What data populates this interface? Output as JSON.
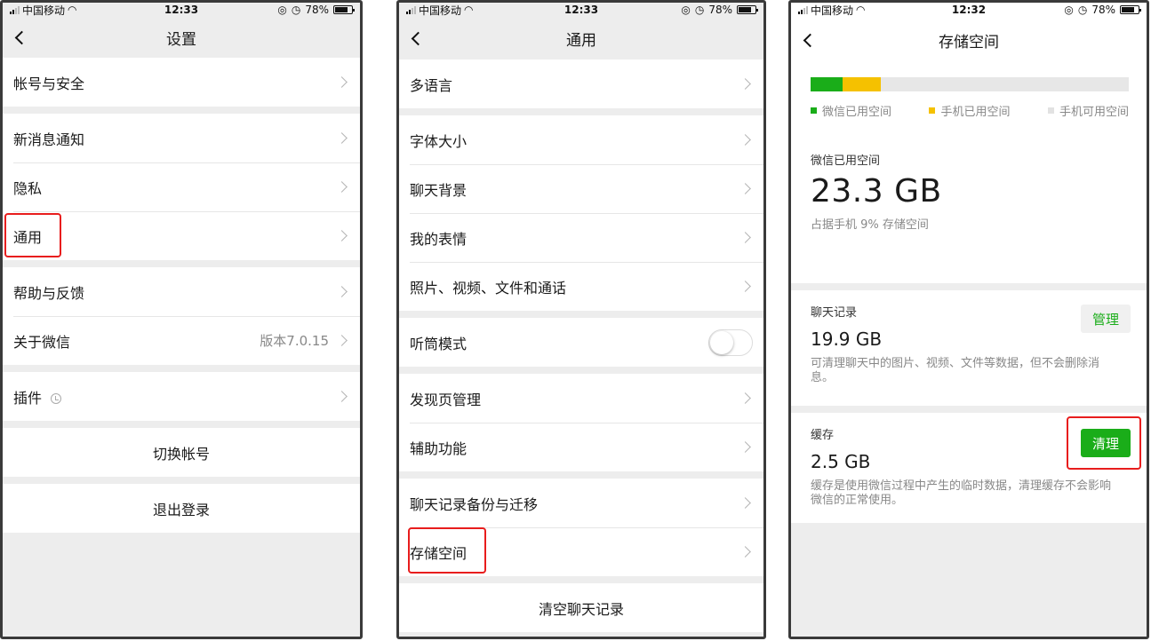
{
  "status": {
    "carrier": "中国移动",
    "time_1": "12:33",
    "time_2": "12:33",
    "time_3": "12:32",
    "battery": "78%",
    "battery_level": 0.78
  },
  "settings": {
    "title": "设置",
    "groups": [
      [
        "帐号与安全"
      ],
      [
        "新消息通知",
        "隐私",
        "通用"
      ],
      [
        "帮助与反馈",
        "关于微信"
      ],
      [
        "插件"
      ]
    ],
    "version_value": "版本7.0.15",
    "switch_account": "切换帐号",
    "logout": "退出登录"
  },
  "general": {
    "title": "通用",
    "groups": [
      [
        "多语言"
      ],
      [
        "字体大小",
        "聊天背景",
        "我的表情",
        "照片、视频、文件和通话"
      ],
      [
        "听筒模式"
      ],
      [
        "发现页管理",
        "辅助功能"
      ],
      [
        "聊天记录备份与迁移",
        "存储空间"
      ]
    ],
    "earpiece_mode_on": false,
    "clear_chat": "清空聊天记录"
  },
  "storage": {
    "title": "存储空间",
    "bar": {
      "wechat_fraction": 0.1,
      "phone_fraction": 0.12
    },
    "legend": {
      "wechat_used": "微信已用空间",
      "phone_used": "手机已用空间",
      "phone_available": "手机可用空间"
    },
    "colors": {
      "wechat": "#1aad19",
      "phone": "#f5c100",
      "free": "#e7e7e7"
    },
    "used_label": "微信已用空间",
    "used_size": "23.3 GB",
    "used_sub": "占据手机 9% 存储空间",
    "chat": {
      "title": "聊天记录",
      "size": "19.9 GB",
      "desc": "可清理聊天中的图片、视频、文件等数据，但不会删除消息。",
      "button": "管理"
    },
    "cache": {
      "title": "缓存",
      "size": "2.5 GB",
      "desc": "缓存是使用微信过程中产生的临时数据，清理缓存不会影响微信的正常使用。",
      "button": "清理"
    }
  }
}
